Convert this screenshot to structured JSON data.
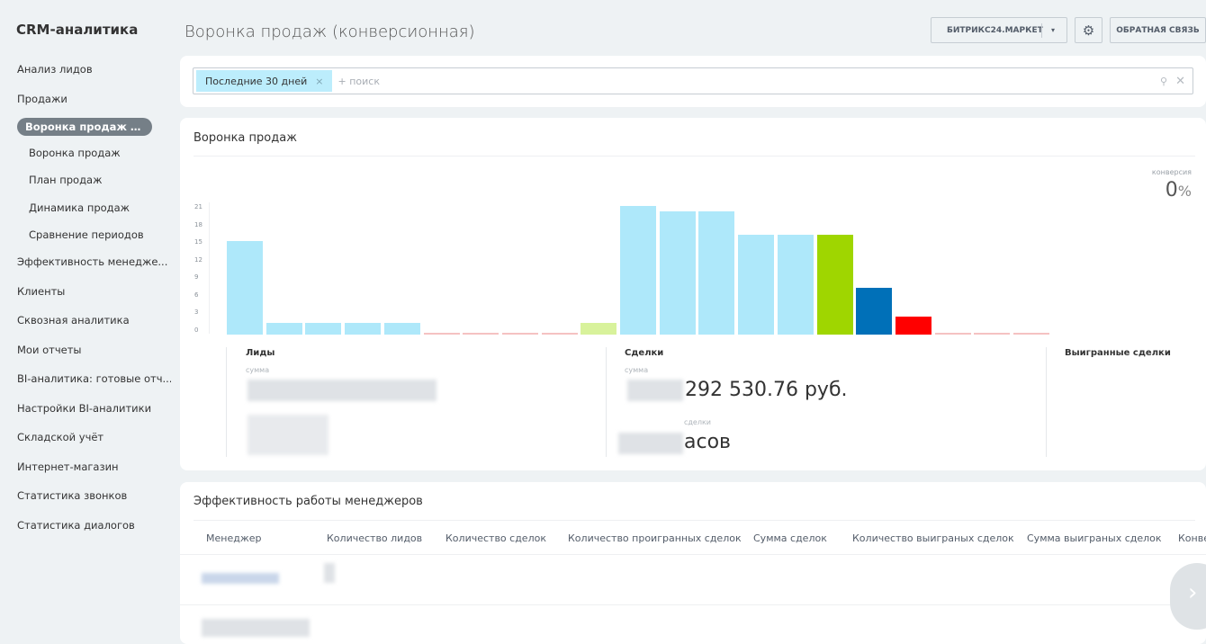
{
  "sidebar": {
    "title": "CRM-аналитика",
    "items": [
      {
        "label": "Анализ лидов",
        "type": "top"
      },
      {
        "label": "Продажи",
        "type": "top"
      },
      {
        "label": "Воронка продаж (кон...",
        "type": "active"
      },
      {
        "label": "Воронка продаж",
        "type": "sub"
      },
      {
        "label": "План продаж",
        "type": "sub"
      },
      {
        "label": "Динамика продаж",
        "type": "sub"
      },
      {
        "label": "Сравнение периодов",
        "type": "sub"
      },
      {
        "label": "Эффективность менедже...",
        "type": "top"
      },
      {
        "label": "Клиенты",
        "type": "top"
      },
      {
        "label": "Сквозная аналитика",
        "type": "top"
      },
      {
        "label": "Мои отчеты",
        "type": "top"
      },
      {
        "label": "BI-аналитика: готовые отч...",
        "type": "top"
      },
      {
        "label": "Настройки BI-аналитики",
        "type": "top"
      },
      {
        "label": "Складской учёт",
        "type": "top"
      },
      {
        "label": "Интернет-магазин",
        "type": "top"
      },
      {
        "label": "Статистика звонков",
        "type": "top"
      },
      {
        "label": "Статистика диалогов",
        "type": "top"
      }
    ]
  },
  "header": {
    "title": "Воронка продаж (конверсионная)",
    "market": "БИТРИКС24.МАРКЕТ",
    "feedback": "ОБРАТНАЯ СВЯЗЬ"
  },
  "filter": {
    "chip": "Последние 30 дней",
    "placeholder": "+ поиск"
  },
  "funnel": {
    "title": "Воронка продаж",
    "conversion_label": "конверсия",
    "conversion_value": "0",
    "conversion_unit": "%",
    "leads": {
      "label": "Лиды",
      "sum_label": "сумма"
    },
    "deals": {
      "label": "Сделки",
      "sum_label": "сумма",
      "sum_value": "292 530.76 руб.",
      "count_label": "сделки",
      "count_value": "асов"
    },
    "won": {
      "label": "Выигранные сделки"
    }
  },
  "chart_data": {
    "type": "bar",
    "yticks": [
      0,
      3,
      6,
      9,
      12,
      15,
      18,
      21
    ],
    "ylim": [
      0,
      22
    ],
    "values": [
      16,
      2,
      2,
      2,
      2,
      0,
      0,
      0,
      0,
      2,
      22,
      21,
      21,
      17,
      17,
      17,
      8,
      3,
      0,
      0,
      0
    ],
    "colors": [
      "#aee8fa",
      "#aee8fa",
      "#aee8fa",
      "#aee8fa",
      "#aee8fa",
      "#f5c2c2",
      "#f5c2c2",
      "#f5c2c2",
      "#f5c2c2",
      "#d8f29b",
      "#aee8fa",
      "#aee8fa",
      "#aee8fa",
      "#aee8fa",
      "#aee8fa",
      "#9fd600",
      "#0070b8",
      "#f00",
      "#f5c2c2",
      "#f5c2c2",
      "#f5c2c2"
    ]
  },
  "managers": {
    "title": "Эффективность работы менеджеров",
    "columns": [
      "Менеджер",
      "Количество лидов",
      "Количество сделок",
      "Количество проигранных сделок",
      "Сумма сделок",
      "Количество выиграных сделок",
      "Сумма выиграных сделок",
      "Конве"
    ]
  }
}
